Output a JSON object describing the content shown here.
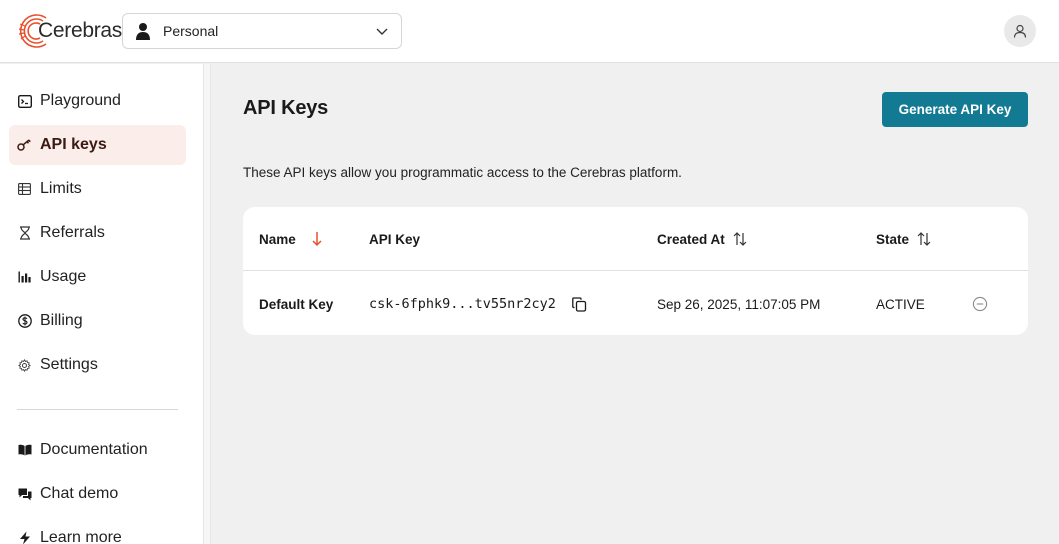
{
  "brand": {
    "name": "Cerebras",
    "accent": "#e8502e"
  },
  "header": {
    "org_select": {
      "value": "Personal",
      "icon": "person-icon"
    },
    "avatar_icon": "user-icon"
  },
  "sidebar": {
    "items": [
      {
        "label": "Playground",
        "icon": "playground-icon"
      },
      {
        "label": "API keys",
        "icon": "key-icon",
        "active": true
      },
      {
        "label": "Limits",
        "icon": "table-icon"
      },
      {
        "label": "Referrals",
        "icon": "hourglass-icon"
      },
      {
        "label": "Usage",
        "icon": "bar-chart-icon"
      },
      {
        "label": "Billing",
        "icon": "dollar-icon"
      },
      {
        "label": "Settings",
        "icon": "gear-icon"
      }
    ],
    "bottom_items": [
      {
        "label": "Documentation",
        "icon": "book-icon"
      },
      {
        "label": "Chat demo",
        "icon": "chat-icon"
      },
      {
        "label": "Learn more",
        "icon": "bolt-icon"
      }
    ]
  },
  "main": {
    "title": "API Keys",
    "generate_button": "Generate API Key",
    "description": "These API keys allow you programmatic access to the Cerebras platform.",
    "table": {
      "columns": [
        "Name",
        "API Key",
        "Created At",
        "State"
      ],
      "rows": [
        {
          "name": "Default Key",
          "api_key": "csk-6fphk9...tv55nr2cy2",
          "created_at": "Sep 26, 2025, 11:07:05 PM",
          "state": "ACTIVE"
        }
      ]
    }
  },
  "colors": {
    "button": "#137a93",
    "active_nav_bg": "#fbeeea",
    "sort_arrow": "#e8502e"
  }
}
